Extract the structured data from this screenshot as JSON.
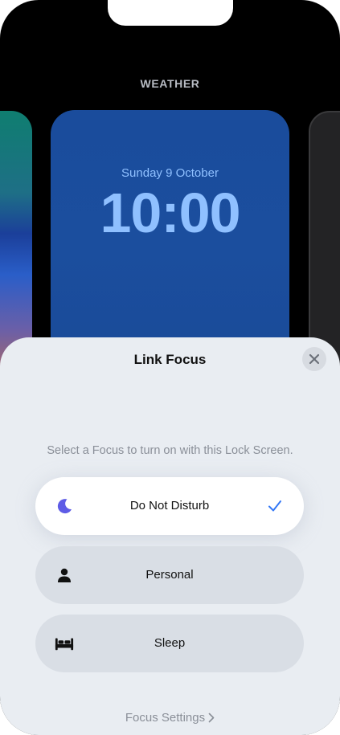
{
  "header": {
    "label": "WEATHER"
  },
  "lock_screen": {
    "date": "Sunday 9 October",
    "time": "10:00"
  },
  "sheet": {
    "title": "Link Focus",
    "subtitle": "Select a Focus to turn on with this Lock Screen.",
    "options": [
      {
        "label": "Do Not Disturb",
        "icon": "moon-icon",
        "selected": true
      },
      {
        "label": "Personal",
        "icon": "person-icon",
        "selected": false
      },
      {
        "label": "Sleep",
        "icon": "bed-icon",
        "selected": false
      }
    ],
    "footer_link": "Focus Settings"
  },
  "colors": {
    "accent": "#3478f6",
    "moon": "#5e5ce6",
    "sheet_bg": "#e9edf2",
    "clock": "#8fc0ff"
  }
}
